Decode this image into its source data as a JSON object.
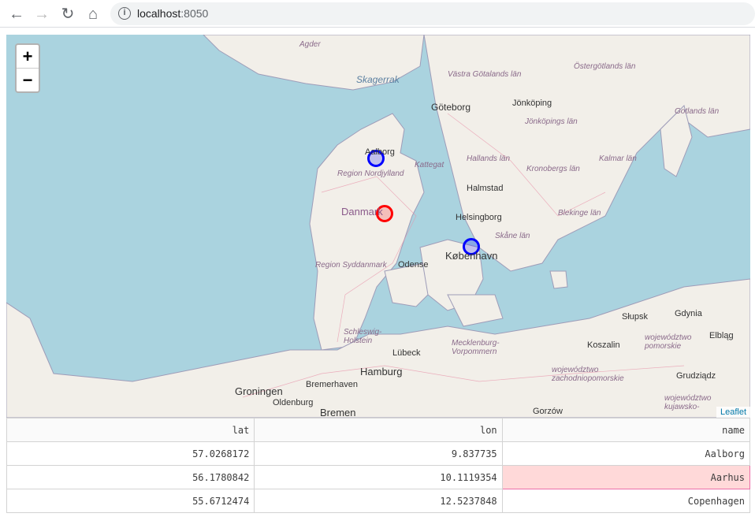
{
  "browser": {
    "url_host": "localhost",
    "url_port": ":8050"
  },
  "map": {
    "zoom_in": "+",
    "zoom_out": "−",
    "attribution": "Leaflet",
    "sea_color": "#aad3df",
    "land_color": "#f2efe9",
    "labels": [
      "Agder",
      "Skagerrak",
      "Västra Götalands län",
      "Östergötlands län",
      "Göteborg",
      "Jönköping",
      "Jönköpings län",
      "Gotlands län",
      "Aalborg",
      "Region Nordjylland",
      "Kattegat",
      "Hallands län",
      "Kronobergs län",
      "Kalmar län",
      "Halmstad",
      "Danmark",
      "Helsingborg",
      "Blekinge län",
      "Skåne län",
      "København",
      "Region Syddanmark",
      "Odense",
      "Słupsk",
      "Gdynia",
      "Schleswig-Holstein",
      "Lübeck",
      "Mecklenburg-Vorpommern",
      "Koszalin",
      "województwo pomorskie",
      "Elbląg",
      "Hamburg",
      "województwo zachodniopomorskie",
      "Grudziądz",
      "Groningen",
      "Bremerhaven",
      "Oldenburg",
      "Bremen",
      "Gorzów",
      "województwo kujawsko-"
    ],
    "markers": [
      {
        "name": "Aalborg",
        "lat": 57.0268172,
        "lon": 9.837735,
        "color": "#0000ff"
      },
      {
        "name": "Aarhus",
        "lat": 56.1780842,
        "lon": 10.1119354,
        "color": "#ff0000"
      },
      {
        "name": "Copenhagen",
        "lat": 55.6712474,
        "lon": 12.5237848,
        "color": "#0000ff"
      }
    ]
  },
  "table": {
    "columns": [
      "lat",
      "lon",
      "name"
    ],
    "rows": [
      [
        "57.0268172",
        "9.837735",
        "Aalborg"
      ],
      [
        "56.1780842",
        "10.1119354",
        "Aarhus"
      ],
      [
        "55.6712474",
        "12.5237848",
        "Copenhagen"
      ]
    ],
    "selected_cell": {
      "row": 1,
      "column": "name"
    }
  }
}
